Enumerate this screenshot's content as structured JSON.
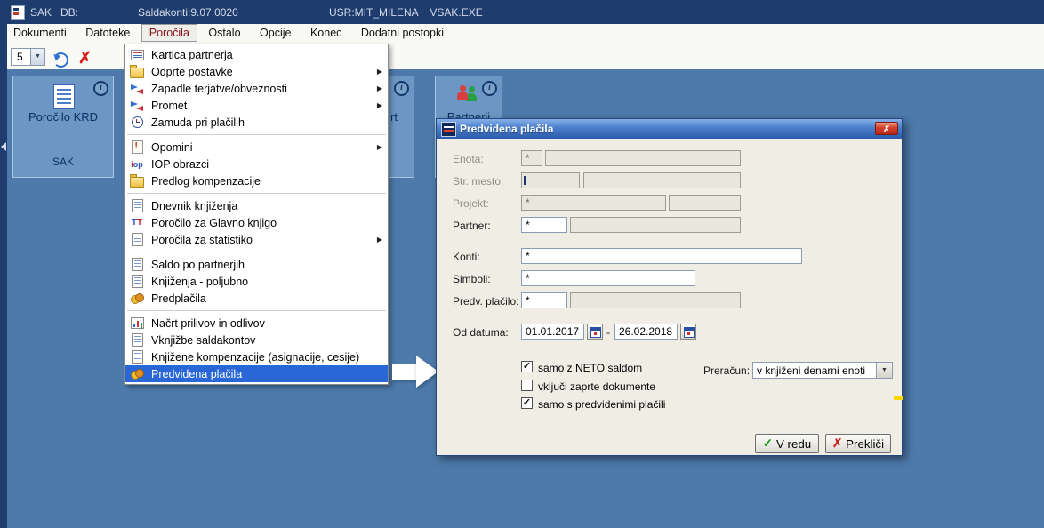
{
  "icons": {
    "info": "i",
    "submenu_arrow": "▶",
    "combo_arrow": "▼",
    "close_x": "✗",
    "delete_x": "✗",
    "check": "✓",
    "cancel_x": "✗",
    "iop": "iop",
    "tt": "TT"
  },
  "titlebar": {
    "app_label": "SAK   DB:",
    "version_label": "Saldakonti:9.07.0020",
    "user_label": "USR:MIT_MILENA    VSAK.EXE"
  },
  "menubar": {
    "items": [
      "Dokumenti",
      "Datoteke",
      "Poročila",
      "Ostalo",
      "Opcije",
      "Konec",
      "Dodatni postopki"
    ],
    "active": "Poročila"
  },
  "toolbar": {
    "combo_value": "5"
  },
  "desktop": {
    "card_krd": {
      "title": "Poročilo KRD",
      "footer": "SAK"
    },
    "card_partial": {
      "visible_text": "rt"
    },
    "card_partnerji": {
      "title": "Partnerji"
    }
  },
  "reports_menu": {
    "items": [
      {
        "label": "Kartica partnerja"
      },
      {
        "label": "Odprte postavke",
        "submenu": true
      },
      {
        "label": "Zapadle terjatve/obveznosti",
        "submenu": true
      },
      {
        "label": "Promet",
        "submenu": true
      },
      {
        "label": "Zamuda pri plačilih"
      },
      {
        "label": "Opomini",
        "submenu": true
      },
      {
        "label": "IOP obrazci"
      },
      {
        "label": "Predlog kompenzacije"
      },
      {
        "label": "Dnevnik knjiženja"
      },
      {
        "label": "Poročilo za Glavno knjigo"
      },
      {
        "label": "Poročila za statistiko",
        "submenu": true
      },
      {
        "label": "Saldo po partnerjih"
      },
      {
        "label": "Knjiženja - poljubno"
      },
      {
        "label": "Predplačila"
      },
      {
        "label": "Načrt prilivov in odlivov"
      },
      {
        "label": "Vknjižbe saldakontov"
      },
      {
        "label": "Knjižene kompenzacije (asignacije, cesije)"
      },
      {
        "label": "Predvidena plačila",
        "selected": true
      }
    ]
  },
  "dialog": {
    "title": "Predvidena plačila",
    "fields": {
      "enota": {
        "label": "Enota:",
        "value1": "*",
        "value2": ""
      },
      "str_mesto": {
        "label": "Str. mesto:",
        "value1": "",
        "value2": ""
      },
      "projekt": {
        "label": "Projekt:",
        "value1": "*",
        "value2": ""
      },
      "partner": {
        "label": "Partner:",
        "value1": "*",
        "value2": ""
      },
      "konti": {
        "label": "Konti:",
        "value": "*"
      },
      "simboli": {
        "label": "Simboli:",
        "value": "*"
      },
      "predv_placilo": {
        "label": "Predv. plačilo:",
        "value1": "*",
        "value2": ""
      },
      "od_datuma": {
        "label": "Od datuma:",
        "from": "01.01.2017",
        "separator": "-",
        "to": "26.02.2018"
      }
    },
    "checkboxes": [
      {
        "label": "samo z NETO saldom",
        "checked": true
      },
      {
        "label": "vključi zaprte dokumente",
        "checked": false
      },
      {
        "label": "samo s predvidenimi plačili",
        "checked": true
      }
    ],
    "preracun": {
      "label": "Preračun:",
      "value": "v knjiženi denarni enoti"
    },
    "buttons": {
      "ok": "V redu",
      "cancel": "Prekliči"
    }
  }
}
